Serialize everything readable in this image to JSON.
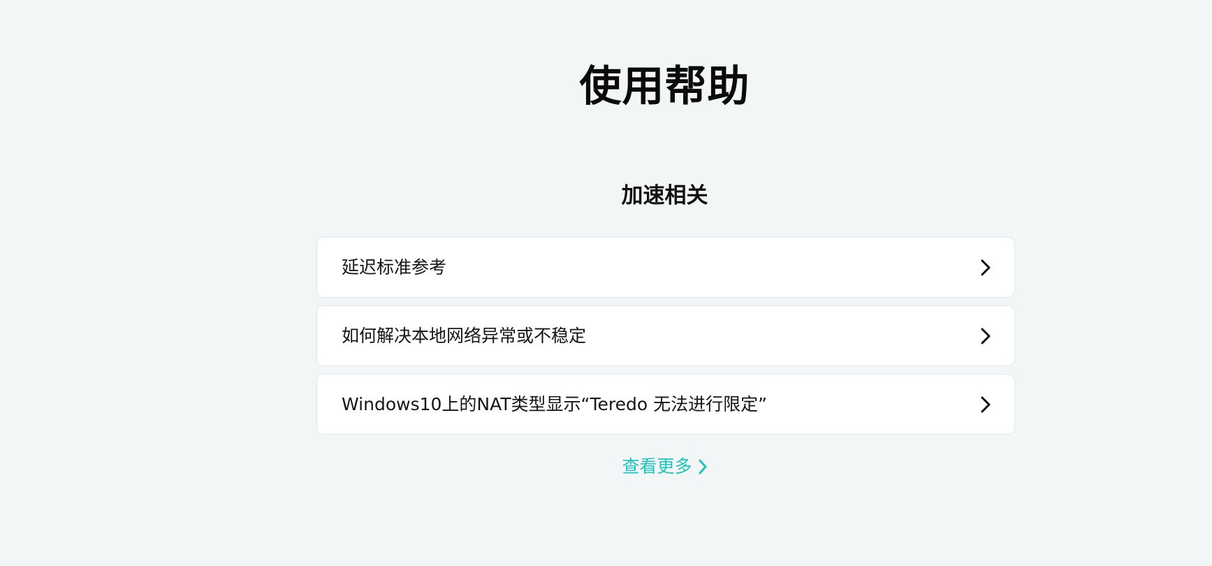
{
  "page": {
    "title": "使用帮助"
  },
  "section": {
    "title": "加速相关",
    "items": [
      {
        "label": "延迟标准参考",
        "icon": "chevron-right-icon"
      },
      {
        "label": "如何解决本地网络异常或不稳定",
        "icon": "chevron-right-icon"
      },
      {
        "label": "Windows10上的NAT类型显示“Teredo 无法进行限定”",
        "icon": "chevron-right-icon"
      }
    ]
  },
  "more_link": {
    "label": "查看更多",
    "icon": "chevron-right-icon",
    "color": "#1cc5bf"
  },
  "colors": {
    "background": "#f3f6f7",
    "card": "#ffffff",
    "accent": "#1cc5bf",
    "text": "#111111"
  }
}
